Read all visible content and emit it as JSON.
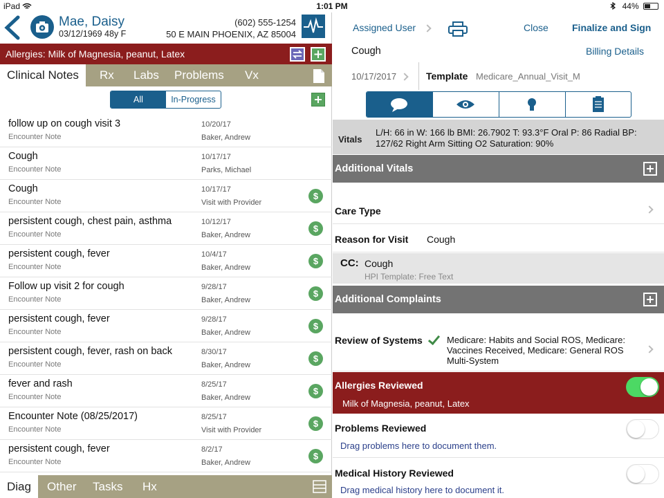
{
  "status_bar": {
    "device": "iPad",
    "time": "1:01 PM",
    "battery": "44%",
    "battery_level": 0.44
  },
  "patient": {
    "name": "Mae, Daisy",
    "dob_line": "03/12/1969  48y  F",
    "phone": "(602) 555-1254",
    "address": "50 E MAIN PHOENIX, AZ 85004"
  },
  "allergy_bar": {
    "text": "Allergies:  Milk of Magnesia, peanut, Latex"
  },
  "top_tabs": [
    "Clinical Notes",
    "Rx",
    "Labs",
    "Problems",
    "Vx"
  ],
  "filter": {
    "all": "All",
    "in_progress": "In-Progress"
  },
  "notes": [
    {
      "title": "follow up on cough visit 3",
      "subtitle": "Encounter Note",
      "date": "10/20/17",
      "provider": "Baker, Andrew",
      "billed": false
    },
    {
      "title": "Cough",
      "subtitle": "Encounter Note",
      "date": "10/17/17",
      "provider": "Parks, Michael",
      "billed": false
    },
    {
      "title": "Cough",
      "subtitle": "Encounter Note",
      "date": "10/17/17",
      "provider": "Visit with Provider",
      "billed": true
    },
    {
      "title": "persistent cough, chest pain, asthma",
      "subtitle": "Encounter Note",
      "date": "10/12/17",
      "provider": "Baker, Andrew",
      "billed": true
    },
    {
      "title": "persistent cough, fever",
      "subtitle": "Encounter Note",
      "date": "10/4/17",
      "provider": "Baker, Andrew",
      "billed": true
    },
    {
      "title": "Follow up visit 2 for cough",
      "subtitle": "Encounter Note",
      "date": "9/28/17",
      "provider": "Baker, Andrew",
      "billed": true
    },
    {
      "title": "persistent cough, fever",
      "subtitle": "Encounter Note",
      "date": "9/28/17",
      "provider": "Baker, Andrew",
      "billed": true
    },
    {
      "title": "persistent cough, fever, rash on back",
      "subtitle": "Encounter Note",
      "date": "8/30/17",
      "provider": "Baker, Andrew",
      "billed": true
    },
    {
      "title": "fever and rash",
      "subtitle": "Encounter Note",
      "date": "8/25/17",
      "provider": "Baker, Andrew",
      "billed": true
    },
    {
      "title": "Encounter Note (08/25/2017)",
      "subtitle": "Encounter Note",
      "date": "8/25/17",
      "provider": "Visit with Provider",
      "billed": true
    },
    {
      "title": "persistent cough, fever",
      "subtitle": "Encounter Note",
      "date": "8/2/17",
      "provider": "Baker, Andrew",
      "billed": true
    }
  ],
  "bottom_tabs": [
    "Diag",
    "Other",
    "Tasks",
    "Hx"
  ],
  "billed_symbol": "$",
  "right": {
    "assigned_user": "Assigned User",
    "close": "Close",
    "finalize": "Finalize and Sign",
    "visit_title": "Cough",
    "billing_details": "Billing Details",
    "visit_date": "10/17/2017",
    "template_label": "Template",
    "template_value": "Medicare_Annual_Visit_M",
    "vitals_label": "Vitals",
    "vitals_value": "L/H: 66 in W: 166 lb BMI: 26.7902 T: 93.3°F Oral P: 86 Radial BP: 127/62 Right Arm Sitting O2 Saturation: 90%",
    "additional_vitals": "Additional Vitals",
    "care_type": "Care Type",
    "reason_label": "Reason for Visit",
    "reason_value": "Cough",
    "cc_label": "CC:",
    "cc_value": "Cough",
    "hpi_template": "HPI Template: Free Text",
    "additional_complaints": "Additional Complaints",
    "ros_label": "Review of Systems",
    "ros_value": "Medicare: Habits and Social ROS, Medicare: Vaccines Received, Medicare: General ROS Multi-System",
    "allergies_reviewed": "Allergies Reviewed",
    "allergies_list": "Milk of Magnesia, peanut, Latex",
    "allergies_on": true,
    "problems_reviewed": "Problems Reviewed",
    "problems_hint": "Drag problems here to document them.",
    "problems_on": false,
    "medhx_reviewed": "Medical History Reviewed",
    "medhx_hint": "Drag medical history here to document it.",
    "medhx_on": false
  },
  "colors": {
    "brand": "#1a5f8c",
    "allergy": "#8b1d1d",
    "tabbar": "#a6a183",
    "green": "#5aa661"
  }
}
